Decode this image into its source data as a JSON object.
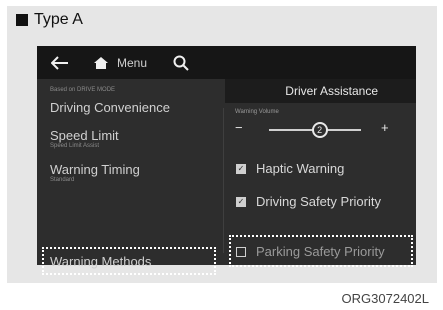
{
  "caption": {
    "label": "Type A"
  },
  "topbar": {
    "back_icon": "arrow-left-icon",
    "home_icon": "home-icon",
    "menu_label": "Menu",
    "search_icon": "search-icon"
  },
  "left_menu": {
    "header": "Based on DRIVE MODE",
    "items": [
      {
        "label": "Driving Convenience",
        "sub": ""
      },
      {
        "label": "Speed Limit",
        "sub": "Speed Limit Assist"
      },
      {
        "label": "Warning Timing",
        "sub": "Standard"
      },
      {
        "label": "Warning Methods",
        "sub": "",
        "highlighted": true
      }
    ]
  },
  "right_panel": {
    "title": "Driver Assistance",
    "volume": {
      "label": "Warning Volume",
      "minus": "−",
      "plus": "+",
      "value": 2,
      "level_fraction": 0.55
    },
    "options": [
      {
        "label": "Haptic Warning",
        "checked": true
      },
      {
        "label": "Driving Safety Priority",
        "checked": true
      },
      {
        "label": "Parking Safety Priority",
        "checked": false,
        "highlighted": true
      }
    ]
  },
  "reference_code": "ORG3072402L"
}
